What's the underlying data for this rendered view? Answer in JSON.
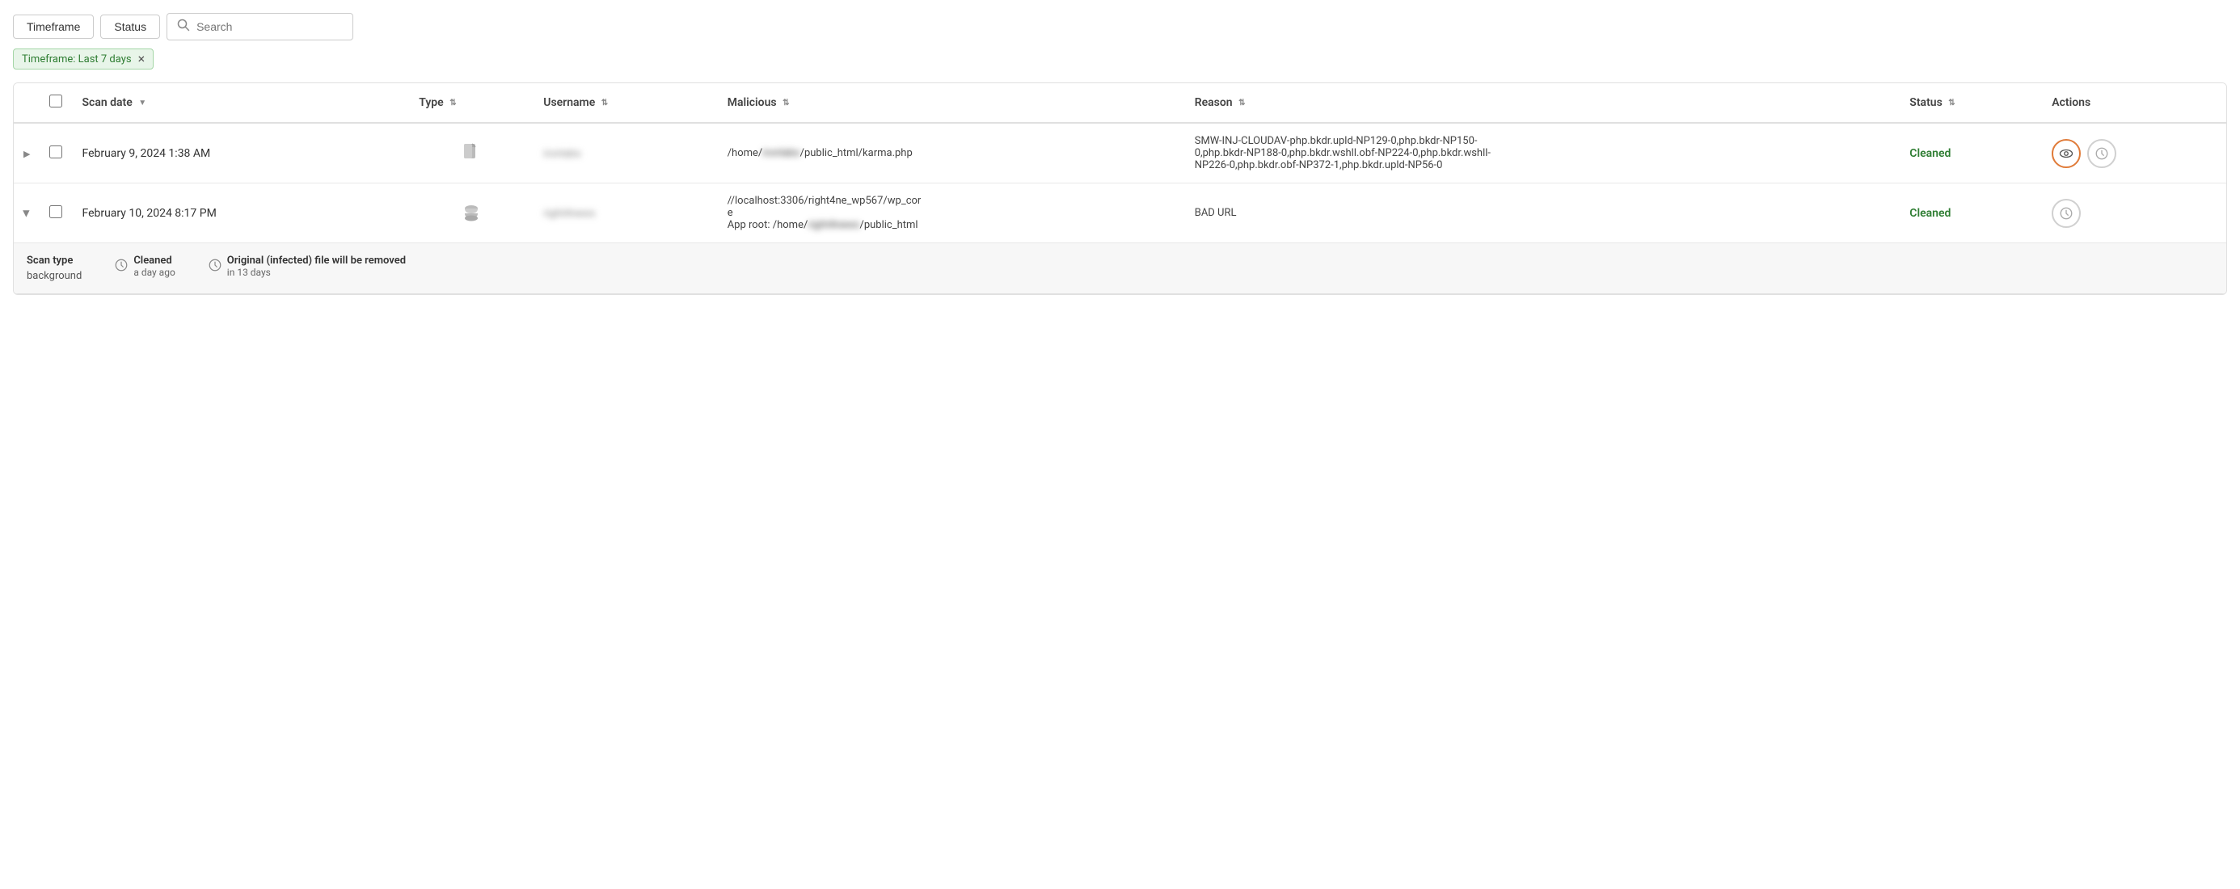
{
  "filters": {
    "timeframe_label": "Timeframe",
    "status_label": "Status",
    "search_placeholder": "Search",
    "active_tag": "Timeframe: Last 7 days",
    "active_tag_close": "×"
  },
  "table": {
    "columns": {
      "scan_date": "Scan date",
      "type": "Type",
      "username": "Username",
      "malicious": "Malicious",
      "reason": "Reason",
      "status": "Status",
      "actions": "Actions"
    },
    "rows": [
      {
        "id": 1,
        "expand_state": "collapsed",
        "scan_date": "February 9, 2024 1:38 AM",
        "type": "file",
        "username": "ironlabs",
        "malicious": "/home/ironlabs/public_html/karma.php",
        "reason": "SMW-INJ-CLOUDAV-php.bkdr.upld-NP129-0,php.bkdr-NP150-0,php.bkdr-NP188-0,php.bkdr.wshll.obf-NP224-0,php.bkdr.wshll-NP226-0,php.bkdr.obf-NP372-1,php.bkdr.upld-NP56-0",
        "status": "Cleaned",
        "has_view": true,
        "has_restore": true,
        "view_active": true
      },
      {
        "id": 2,
        "expand_state": "expanded",
        "scan_date": "February 10, 2024 8:17 PM",
        "type": "database",
        "username": "right4news",
        "malicious": "//localhost:3306/right4ne_wp567/wp_core\nApp root: /home/right4news/public_html",
        "reason": "BAD URL",
        "status": "Cleaned",
        "has_view": false,
        "has_restore": true,
        "view_active": false
      }
    ],
    "sub_row": {
      "scan_type_label": "Scan type",
      "scan_type_value": "background",
      "cleaned_label": "Cleaned",
      "cleaned_time": "a day ago",
      "original_label": "Original (infected) file will be removed",
      "original_time": "in 13 days"
    }
  }
}
